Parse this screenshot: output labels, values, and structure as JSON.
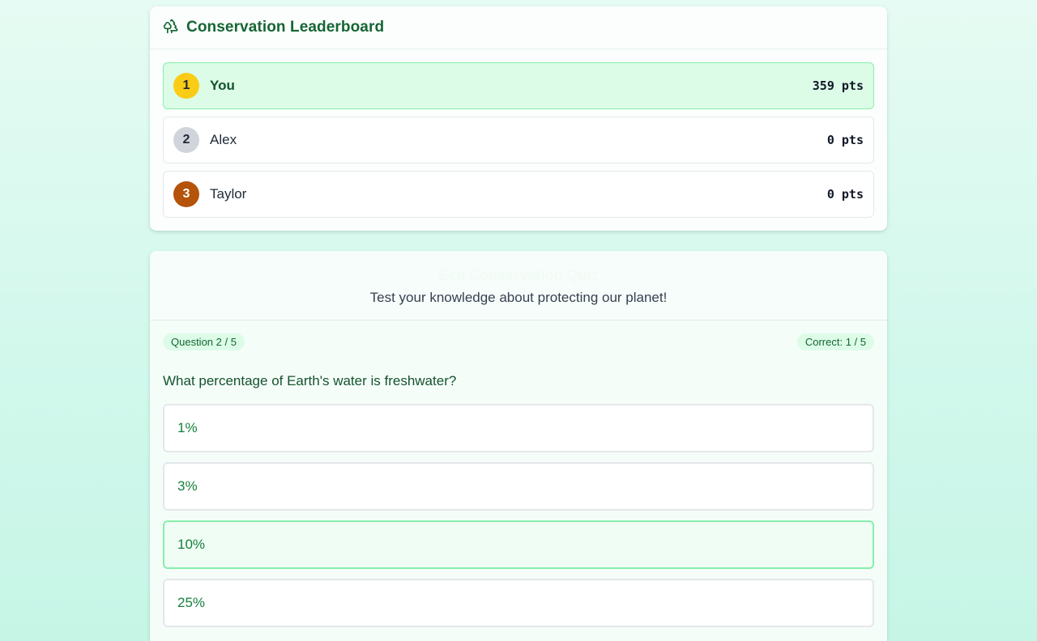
{
  "leaderboard": {
    "title": "Conservation Leaderboard",
    "icon": "trees-icon",
    "entries": [
      {
        "rank": "1",
        "name": "You",
        "points": "359 pts"
      },
      {
        "rank": "2",
        "name": "Alex",
        "points": "0 pts"
      },
      {
        "rank": "3",
        "name": "Taylor",
        "points": "0 pts"
      }
    ]
  },
  "quiz": {
    "title": "Eco Conservation Quiz",
    "subtitle": "Test your knowledge about protecting our planet!",
    "progress": "Question 2 / 5",
    "score": "Correct: 1 / 5",
    "question": "What percentage of Earth's water is freshwater?",
    "answers": [
      "1%",
      "3%",
      "10%",
      "25%"
    ],
    "selected_answer": "10%"
  },
  "colors": {
    "accent": "#166534",
    "highlight": "#dcfce7",
    "gold": "#facc15",
    "silver": "#d1d5db",
    "bronze": "#b45309"
  }
}
